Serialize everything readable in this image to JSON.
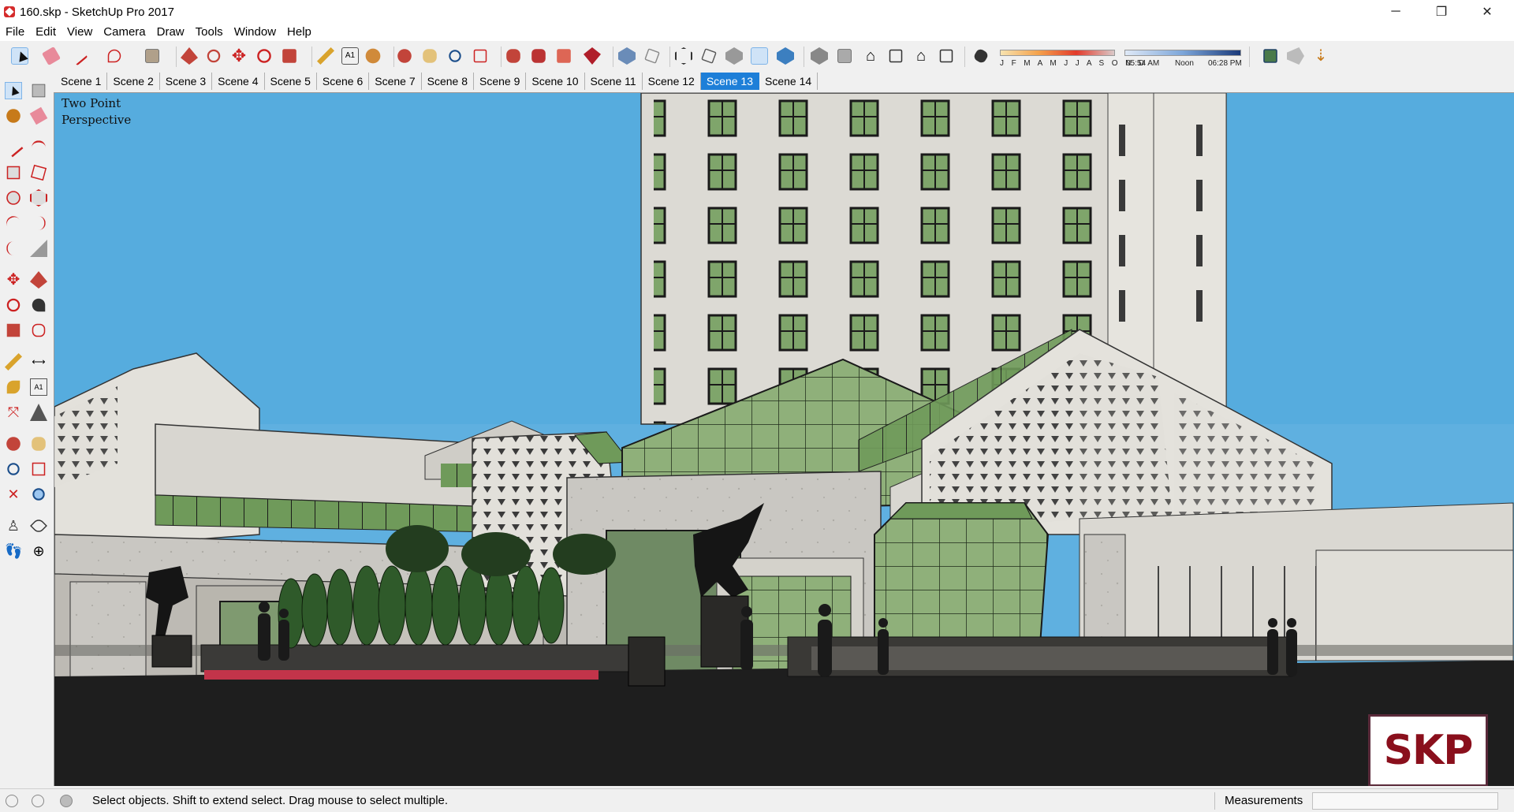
{
  "window": {
    "title": "160.skp - SketchUp Pro 2017",
    "minimize": "─",
    "restore": "❐",
    "close": "✕"
  },
  "menu": [
    "File",
    "Edit",
    "View",
    "Camera",
    "Draw",
    "Tools",
    "Window",
    "Help"
  ],
  "shadow_settings": {
    "months": "J F M A M J J A S O N D",
    "time_start": "05:54 AM",
    "time_mid": "Noon",
    "time_end": "06:28 PM"
  },
  "scenes": {
    "tabs": [
      "Scene 1",
      "Scene 2",
      "Scene 3",
      "Scene 4",
      "Scene 5",
      "Scene 6",
      "Scene 7",
      "Scene 8",
      "Scene 9",
      "Scene 10",
      "Scene 11",
      "Scene 12",
      "Scene 13",
      "Scene 14"
    ],
    "active": "Scene 13"
  },
  "viewport": {
    "camera_label": "Two Point\nPerspective",
    "watermark": "SKP",
    "sky_color": "#5fb0e0",
    "facade_color": "#dcdad4",
    "glass_color": "#8fb07a"
  },
  "status": {
    "hint": "Select objects. Shift to extend select. Drag mouse to select multiple.",
    "measurements_label": "Measurements",
    "measurements_value": ""
  }
}
